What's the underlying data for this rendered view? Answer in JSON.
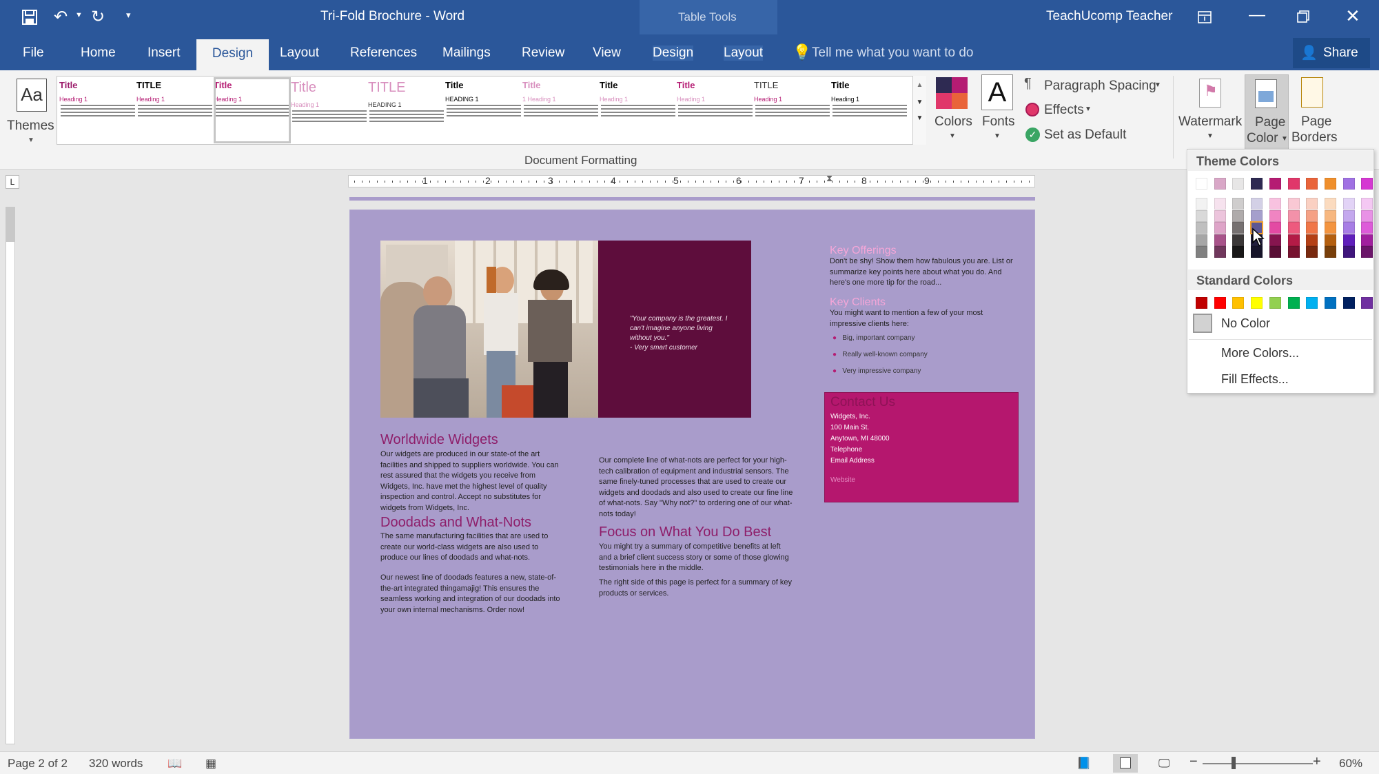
{
  "window": {
    "title": "Tri-Fold Brochure - Word",
    "context_tab": "Table Tools",
    "user": "TeachUcomp Teacher"
  },
  "tabs": [
    "File",
    "Home",
    "Insert",
    "Design",
    "Layout",
    "References",
    "Mailings",
    "Review",
    "View",
    "Design",
    "Layout"
  ],
  "active_tab": "Design",
  "tell_me": "Tell me what you want to do",
  "share_label": "Share",
  "ribbon": {
    "themes_label": "Themes",
    "style_set": [
      {
        "title": "Title",
        "head": "Heading 1"
      },
      {
        "title": "TITLE",
        "head": "Heading 1"
      },
      {
        "title": "Title",
        "head": "Heading 1"
      },
      {
        "title": "Title",
        "head": "Heading 1"
      },
      {
        "title": "TITLE",
        "head": "HEADING 1"
      },
      {
        "title": "Title",
        "head": "HEADING 1"
      },
      {
        "title": "Title",
        "head": "1 Heading 1"
      },
      {
        "title": "Title",
        "head": "Heading 1"
      },
      {
        "title": "Title",
        "head": "Heading 1"
      },
      {
        "title": "TITLE",
        "head": "Heading 1"
      },
      {
        "title": "Title",
        "head": "Heading 1"
      }
    ],
    "group_label": "Document Formatting",
    "colors_label": "Colors",
    "fonts_label": "Fonts",
    "paragraph_spacing_label": "Paragraph Spacing",
    "effects_label": "Effects",
    "set_default_label": "Set as Default",
    "watermark_label": "Watermark",
    "page_color_label_1": "Page",
    "page_color_label_2": "Color",
    "page_borders_label_1": "Page",
    "page_borders_label_2": "Borders"
  },
  "ruler_numbers": [
    "1",
    "2",
    "3",
    "4",
    "5",
    "6",
    "7",
    "8",
    "9"
  ],
  "page_color_menu": {
    "theme_header": "Theme Colors",
    "standard_header": "Standard Colors",
    "no_color": "No Color",
    "more_colors": "More Colors...",
    "fill_effects": "Fill Effects...",
    "theme_top_row": [
      "#ffffff",
      "#d9a7c7",
      "#e7e6e6",
      "#2e2a52",
      "#b51c73",
      "#e0376a",
      "#e9643a",
      "#ef8f2c",
      "#a071e3",
      "#d538d2"
    ],
    "theme_shades": [
      [
        "#f2f2f2",
        "#f6e2ee",
        "#cfcdcd",
        "#d3d0e6",
        "#f8c2e0",
        "#f9c8d4",
        "#fad0c2",
        "#fbdbbf",
        "#e2d3f6",
        "#f4c8f3"
      ],
      [
        "#d9d9d9",
        "#ecc4dc",
        "#afabab",
        "#a59fcc",
        "#f084c2",
        "#f391a9",
        "#f5a185",
        "#f7b77f",
        "#c4a8ee",
        "#e891e6"
      ],
      [
        "#bfbfbf",
        "#dea4c8",
        "#767171",
        "#5d5794",
        "#e34aa3",
        "#ed5a7e",
        "#f07648",
        "#f3943f",
        "#a77de5",
        "#dd5bd9"
      ],
      [
        "#a6a6a6",
        "#a8538a",
        "#3b3838",
        "#221f3d",
        "#86154f",
        "#b31b46",
        "#b44016",
        "#b45f0f",
        "#5f1fbb",
        "#a11f9e"
      ],
      [
        "#808080",
        "#70375c",
        "#181717",
        "#161429",
        "#590e35",
        "#77122f",
        "#78290f",
        "#783f0a",
        "#3f157c",
        "#6b1569"
      ]
    ],
    "standard_row": [
      "#c00000",
      "#ff0000",
      "#ffc000",
      "#ffff00",
      "#92d050",
      "#00b050",
      "#00b0f0",
      "#0070c0",
      "#002060",
      "#7030a0"
    ]
  },
  "document": {
    "quote_1": "\"Your company is the greatest. I can't imagine anyone living without you.\"",
    "quote_2": "- Very smart customer",
    "h_worldwide": "Worldwide Widgets",
    "p_worldwide": "Our widgets are produced in our state-of the art facilities and shipped to suppliers worldwide. You can rest assured that the widgets you receive from Widgets, Inc. have met the highest level of quality inspection and control. Accept no substitutes for widgets from Widgets, Inc.",
    "h_doodads": "Doodads and What-Nots",
    "p_doodads_1": "The same manufacturing facilities that are used to create our world-class widgets are also used to produce our lines of doodads and what-nots.",
    "p_doodads_2": "Our newest line of doodads features a new, state-of-the-art integrated thingamajig! This ensures the seamless working and integration of our doodads into your own internal mechanisms. Order now!",
    "p_whatnots": "Our complete line of what-nots are perfect for your high-tech calibration of equipment and industrial sensors. The same finely-tuned processes that are used to create our widgets and doodads and also used to create our fine line of what-nots. Say \"Why not?\" to ordering one of our what-nots today!",
    "h_focus": "Focus on What You Do Best",
    "p_focus_1": "You might try a summary of competitive benefits at left and a brief client success story or some of those glowing testimonials here in the middle.",
    "p_focus_2": "The right side of this page is perfect for a summary of key products or services.",
    "h_offerings": "Key Offerings",
    "p_offerings": "Don't be shy! Show them how fabulous you are. List or summarize key points here about what you do. And here's one more tip for the road...",
    "h_clients": "Key Clients",
    "p_clients": "You might want to mention a few of your most impressive clients here:",
    "clients": [
      "Big, important company",
      "Really well-known company",
      "Very impressive company"
    ],
    "contact_title": "Contact Us",
    "contact_lines": [
      "Widgets, Inc.",
      "100 Main St.",
      "Anytown, MI 48000",
      "Telephone",
      "Email Address"
    ],
    "contact_website": "Website"
  },
  "status": {
    "page": "Page 2 of 2",
    "words": "320 words",
    "zoom": "60%"
  }
}
